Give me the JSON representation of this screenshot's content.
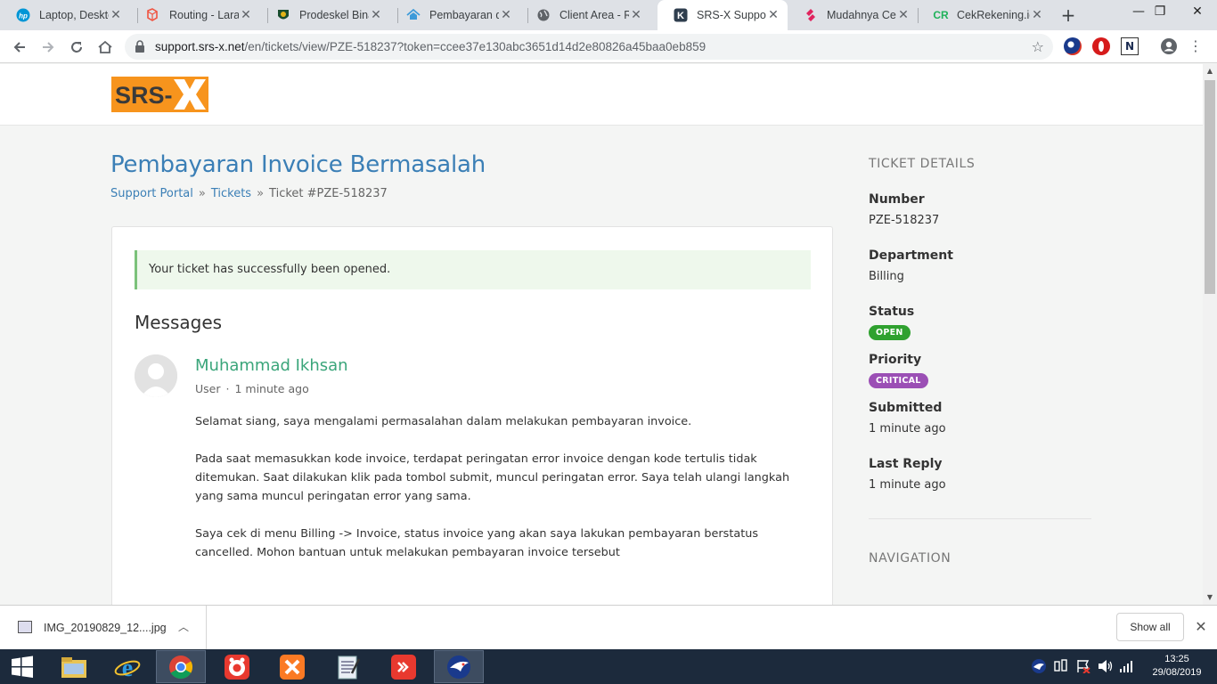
{
  "browser": {
    "tabs": [
      {
        "title": "Laptop, Desktop",
        "favicon": "hp-icon",
        "color": "#0096d6"
      },
      {
        "title": "Routing - Laravel",
        "favicon": "laravel-icon",
        "color": "#f05340"
      },
      {
        "title": "Prodeskel Bina",
        "favicon": "emblem-icon",
        "color": "#1a4d2e"
      },
      {
        "title": "Pembayaran do",
        "favicon": "home-icon",
        "color": "#3b9ad9"
      },
      {
        "title": "Client Area - Ru",
        "favicon": "globe-icon",
        "color": "#5f6368"
      },
      {
        "title": "SRS-X Support",
        "favicon": "kayako-icon",
        "color": "#2f3e4e"
      },
      {
        "title": "Mudahnya Cek",
        "favicon": "cek-icon",
        "color": "#e0245e"
      },
      {
        "title": "CekRekening.id",
        "favicon": "cr-icon",
        "color": "#1fb25a"
      }
    ],
    "url_host": "support.srs-x.net",
    "url_path": "/en/tickets/view/PZE-518237?token=ccee37e130abc3651d14d2e80826a45baa0eb859"
  },
  "site": {
    "logo_text": "SRS-X",
    "logo_color": "#f7941d"
  },
  "ticket": {
    "title": "Pembayaran Invoice Bermasalah",
    "breadcrumb": {
      "home": "Support Portal",
      "tickets": "Tickets",
      "current": "Ticket #PZE-518237",
      "sep": "»"
    },
    "alert": "Your ticket has successfully been opened.",
    "messages_heading": "Messages",
    "message": {
      "author": "Muhammad Ikhsan",
      "role": "User",
      "time": "1 minute ago",
      "paragraphs": [
        "Selamat siang, saya mengalami permasalahan dalam melakukan pembayaran invoice.",
        "Pada saat memasukkan kode invoice, terdapat peringatan error invoice dengan kode tertulis tidak ditemukan. Saat dilakukan klik pada tombol submit, muncul peringatan error. Saya telah ulangi langkah yang sama muncul peringatan error yang sama.",
        "Saya cek di menu Billing -> Invoice, status invoice yang akan saya lakukan pembayaran berstatus cancelled. Mohon bantuan untuk melakukan pembayaran invoice tersebut"
      ]
    }
  },
  "details": {
    "heading": "TICKET DETAILS",
    "number_label": "Number",
    "number": "PZE-518237",
    "department_label": "Department",
    "department": "Billing",
    "status_label": "Status",
    "status": "OPEN",
    "status_color": "#2fa12f",
    "priority_label": "Priority",
    "priority": "CRITICAL",
    "priority_color": "#9b4fb5",
    "submitted_label": "Submitted",
    "submitted": "1 minute ago",
    "last_reply_label": "Last Reply",
    "last_reply": "1 minute ago",
    "navigation_heading": "NAVIGATION"
  },
  "downloads": {
    "file": "IMG_20190829_12....jpg",
    "show_all": "Show all"
  },
  "taskbar": {
    "time": "13:25",
    "date": "29/08/2019"
  }
}
